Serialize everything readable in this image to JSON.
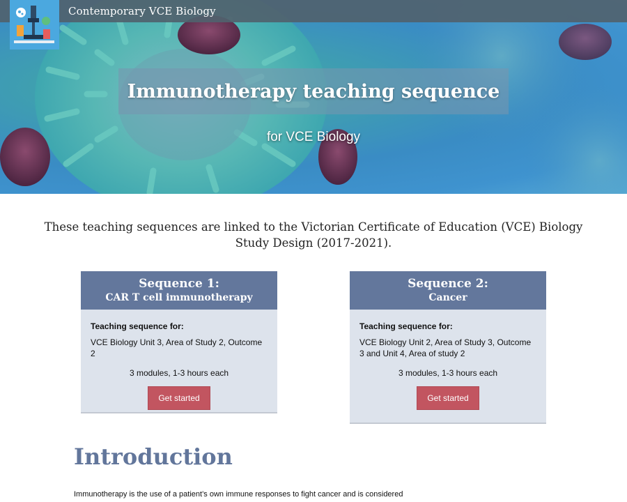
{
  "header": {
    "site_title": "Contemporary VCE Biology",
    "logo_icon": "microscope-science-logo-icon"
  },
  "hero": {
    "title": "Immunotherapy teaching sequence",
    "subtitle": "for VCE Biology"
  },
  "intro_lead": "These teaching sequences are linked to the Victorian Certificate of Education (VCE) Biology Study Design (2017-2021).",
  "sequences": [
    {
      "heading": "Sequence 1:",
      "name": "CAR T cell immunotherapy",
      "for_label": "Teaching sequence for:",
      "unit": "VCE Biology Unit 3, Area of Study 2, Outcome 2",
      "modules": "3 modules, 1-3 hours each",
      "button": "Get started"
    },
    {
      "heading": "Sequence 2:",
      "name": "Cancer",
      "for_label": "Teaching sequence for:",
      "unit": "VCE Biology Unit 2, Area of Study 3, Outcome 3 and Unit 4, Area of study 2",
      "modules": "3 modules, 1-3 hours each",
      "button": "Get started"
    }
  ],
  "introduction": {
    "title": "Introduction",
    "text": "Immunotherapy is the use of a patient’s own immune responses to fight cancer and is considered"
  },
  "colors": {
    "topbar": "#50626e",
    "card_header": "#63779c",
    "card_body": "#dde3ec",
    "button": "#c25560",
    "section_title": "#62769b"
  }
}
